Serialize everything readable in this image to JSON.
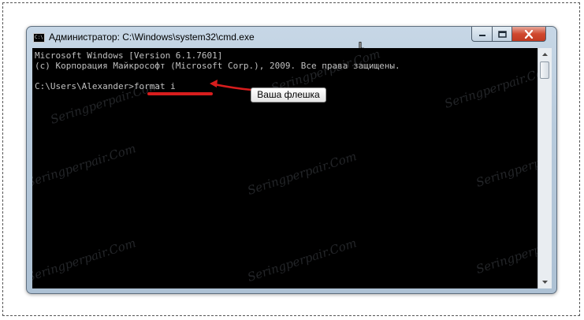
{
  "window": {
    "title": "Администратор: C:\\Windows\\system32\\cmd.exe",
    "icon": "cmd-icon"
  },
  "console": {
    "lines": [
      "Microsoft Windows [Version 6.1.7601]",
      "(c) Корпорация Майкрософт (Microsoft Corp.), 2009. Все права защищены.",
      "",
      "C:\\Users\\Alexander>format i"
    ]
  },
  "annotation": {
    "callout_text": "Ваша флешка",
    "color": "#d81d1d"
  },
  "watermark": {
    "text": "Seringperpair.Com"
  },
  "controls": {
    "minimize_icon": "minimize-icon",
    "maximize_icon": "maximize-icon",
    "close_icon": "close-icon"
  }
}
